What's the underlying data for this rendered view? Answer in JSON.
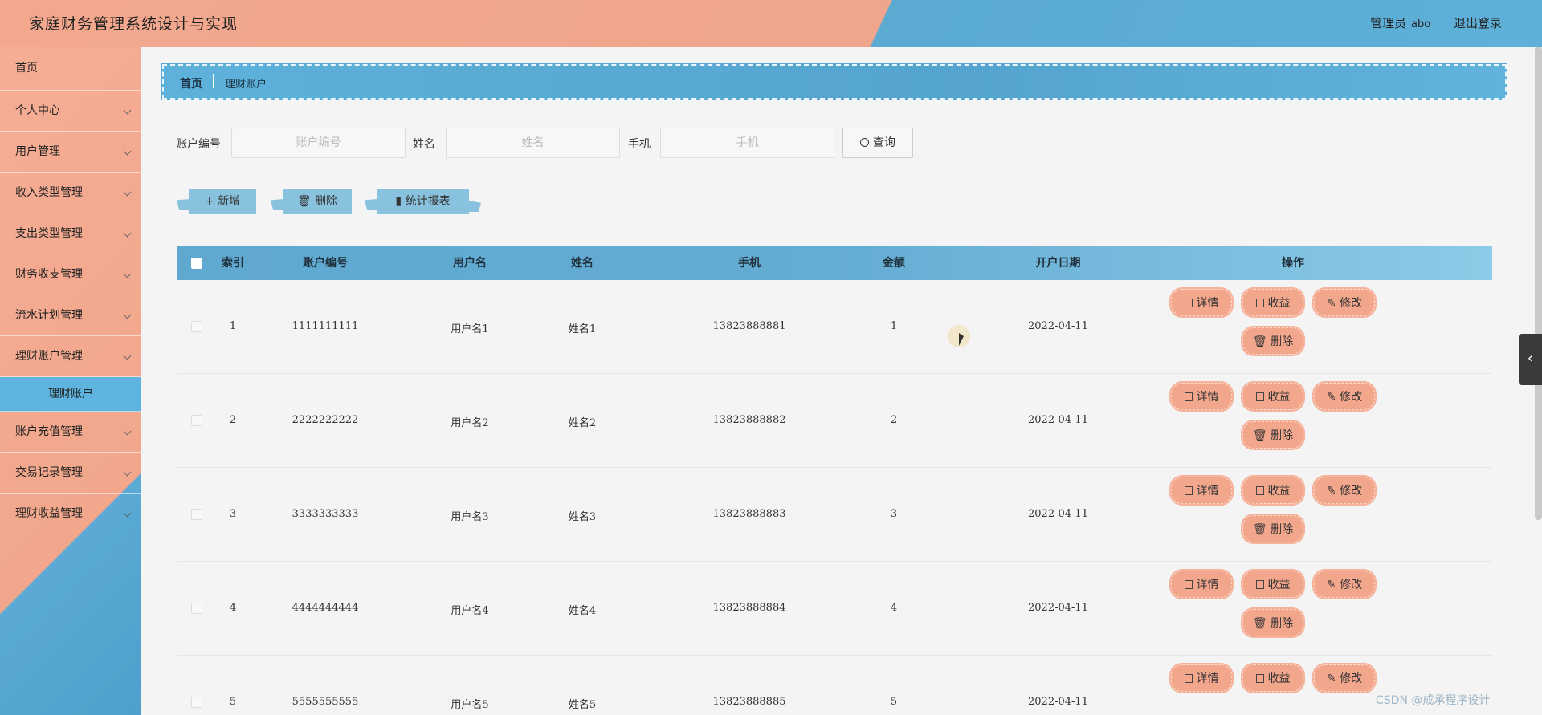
{
  "header": {
    "title": "家庭财务管理系统设计与实现",
    "user_label": "管理员",
    "username": "abo",
    "logout": "退出登录"
  },
  "sidebar": {
    "home": "首页",
    "items": [
      {
        "label": "个人中心"
      },
      {
        "label": "用户管理"
      },
      {
        "label": "收入类型管理"
      },
      {
        "label": "支出类型管理"
      },
      {
        "label": "财务收支管理"
      },
      {
        "label": "流水计划管理"
      },
      {
        "label": "理财账户管理"
      }
    ],
    "active_sub": "理财账户",
    "items_after": [
      {
        "label": "账户充值管理"
      },
      {
        "label": "交易记录管理"
      },
      {
        "label": "理财收益管理"
      }
    ]
  },
  "breadcrumb": {
    "home": "首页",
    "current": "理财账户"
  },
  "search": {
    "account_label": "账户编号",
    "account_placeholder": "账户编号",
    "name_label": "姓名",
    "name_placeholder": "姓名",
    "phone_label": "手机",
    "phone_placeholder": "手机",
    "query": "查询"
  },
  "actions": {
    "add": "新增",
    "delete": "删除",
    "report": "统计报表"
  },
  "table": {
    "headers": {
      "index": "索引",
      "account": "账户编号",
      "username": "用户名",
      "name": "姓名",
      "phone": "手机",
      "amount": "金额",
      "date": "开户日期",
      "ops": "操作"
    },
    "rows": [
      {
        "index": "1",
        "account": "1111111111",
        "username": "用户名1",
        "name": "姓名1",
        "phone": "13823888881",
        "amount": "1",
        "date": "2022-04-11"
      },
      {
        "index": "2",
        "account": "2222222222",
        "username": "用户名2",
        "name": "姓名2",
        "phone": "13823888882",
        "amount": "2",
        "date": "2022-04-11"
      },
      {
        "index": "3",
        "account": "3333333333",
        "username": "用户名3",
        "name": "姓名3",
        "phone": "13823888883",
        "amount": "3",
        "date": "2022-04-11"
      },
      {
        "index": "4",
        "account": "4444444444",
        "username": "用户名4",
        "name": "姓名4",
        "phone": "13823888884",
        "amount": "4",
        "date": "2022-04-11"
      },
      {
        "index": "5",
        "account": "5555555555",
        "username": "用户名5",
        "name": "姓名5",
        "phone": "13823888885",
        "amount": "5",
        "date": "2022-04-11"
      }
    ],
    "op_labels": {
      "detail": "详情",
      "income": "收益",
      "edit": "修改",
      "delete": "删除"
    }
  },
  "watermark": "CSDN @成承程序设计",
  "colors": {
    "accent_orange": "#f2a68c",
    "accent_blue": "#5eb0d8"
  }
}
